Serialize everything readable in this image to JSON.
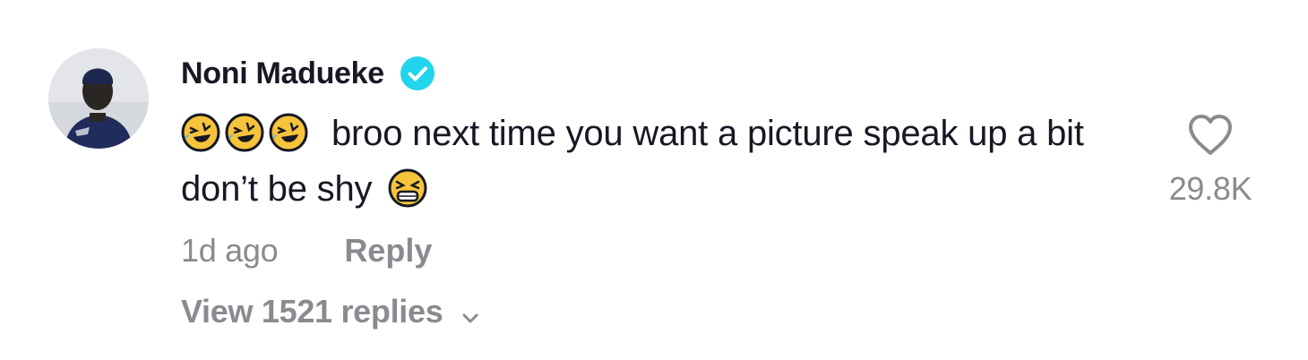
{
  "comment": {
    "author": {
      "name": "Noni Madueke",
      "verified": true,
      "avatar_icon": "avatar-photo"
    },
    "emojis_leading": [
      "rolling-on-floor-laughing-icon",
      "rolling-on-floor-laughing-icon",
      "rolling-on-floor-laughing-icon"
    ],
    "text_line": "broo next time you want a picture speak up a bit don’t be shy",
    "emoji_trailing": "tired-face-icon",
    "timestamp": "1d ago",
    "reply_label": "Reply",
    "view_replies_label": "View 1521 replies",
    "like_count": "29.8K"
  },
  "colors": {
    "primary_text": "#161823",
    "secondary_text": "#8a8b91",
    "verified_badge": "#20d5ec",
    "emoji_yellow": "#f7c33b"
  }
}
